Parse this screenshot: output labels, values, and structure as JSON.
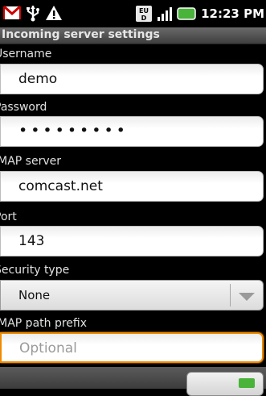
{
  "status_bar": {
    "time": "12:23 PM",
    "left_icons": [
      "gmail-icon",
      "usb-icon",
      "warning-icon"
    ],
    "right_icons": [
      "eu-roaming-icon",
      "signal-icon",
      "battery-icon"
    ]
  },
  "title": "Incoming server settings",
  "fields": {
    "username": {
      "label": "Username",
      "value": "demo"
    },
    "password": {
      "label": "Password",
      "value": "•••••••••"
    },
    "imap_server": {
      "label": "IMAP server",
      "value": "comcast.net"
    },
    "port": {
      "label": "Port",
      "value": "143"
    },
    "security_type": {
      "label": "Security type",
      "value": "None"
    },
    "imap_path_prefix": {
      "label": "IMAP path prefix",
      "value": "",
      "placeholder": "Optional"
    }
  },
  "colors": {
    "focus": "#f08a00",
    "battery": "#49b33a"
  }
}
